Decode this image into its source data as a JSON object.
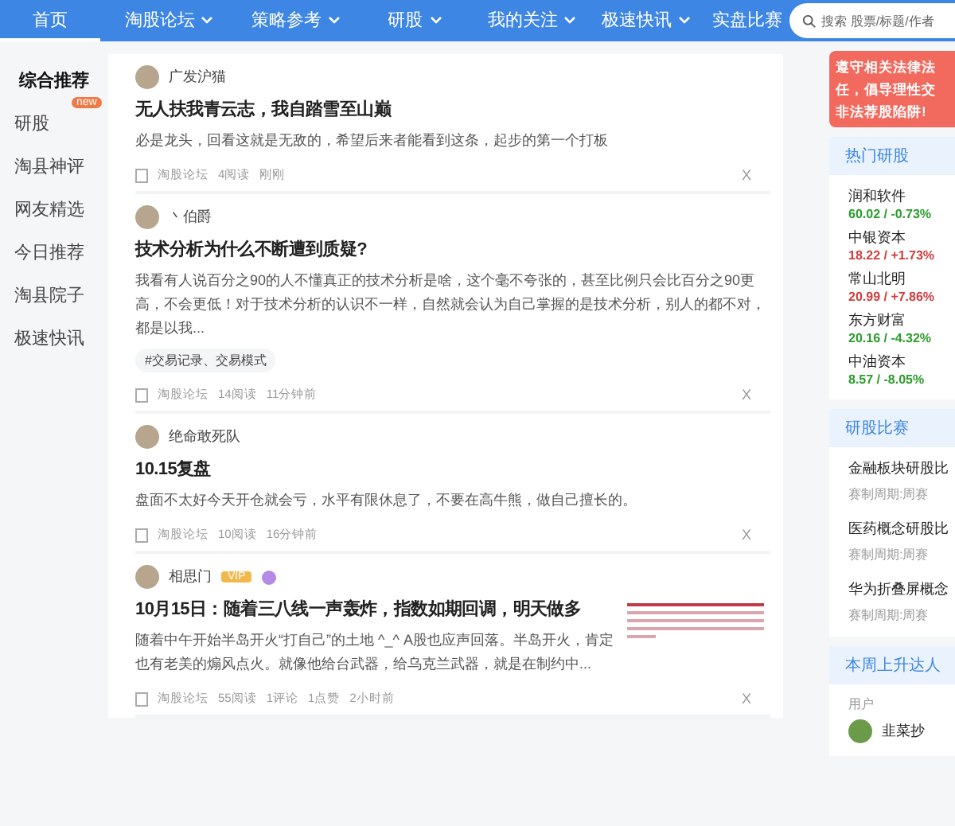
{
  "nav": {
    "items": [
      {
        "label": "首页",
        "selected": true,
        "dropdown": false
      },
      {
        "label": "淘股论坛",
        "selected": false,
        "dropdown": true
      },
      {
        "label": "策略参考",
        "selected": false,
        "dropdown": true
      },
      {
        "label": "研股",
        "selected": false,
        "dropdown": true
      },
      {
        "label": "我的关注",
        "selected": false,
        "dropdown": true
      },
      {
        "label": "极速快讯",
        "selected": false,
        "dropdown": true
      },
      {
        "label": "实盘比赛",
        "selected": false,
        "dropdown": false
      }
    ],
    "search": {
      "placeholder": "搜索 股票/标题/作者"
    }
  },
  "sidebar": {
    "items": [
      {
        "label": "综合推荐",
        "selected": true
      },
      {
        "label": "研股",
        "selected": false,
        "badge": "new"
      },
      {
        "label": "淘县神评",
        "selected": false
      },
      {
        "label": "网友精选",
        "selected": false
      },
      {
        "label": "今日推荐",
        "selected": false
      },
      {
        "label": "淘县院子",
        "selected": false
      },
      {
        "label": "极速快讯",
        "selected": false
      }
    ]
  },
  "feed": [
    {
      "author": "广发沪猫",
      "vip": false,
      "title": "无人扶我青云志，我自踏雪至山巅",
      "summary": "必是龙头，回看这就是无敌的，希望后来者能看到这条，起步的第一个打板",
      "meta": [
        "淘股论坛",
        "4阅读",
        "刚刚"
      ],
      "dismiss": "X",
      "thumbnail": false
    },
    {
      "author": "丶伯爵",
      "vip": false,
      "title": "技术分析为什么不断遭到质疑?",
      "summary": "我看有人说百分之90的人不懂真正的技术分析是啥，这个毫不夸张的，甚至比例只会比百分之90更高，不会更低！对于技术分析的认识不一样，自然就会认为自己掌握的是技术分析，别人的都不对，都是以我...",
      "tags": [
        "#交易记录、交易模式"
      ],
      "meta": [
        "淘股论坛",
        "14阅读",
        "11分钟前"
      ],
      "dismiss": "X",
      "thumbnail": false
    },
    {
      "author": "绝命敢死队",
      "vip": false,
      "title": "10.15复盘",
      "summary": "盘面不太好今天开仓就会亏，水平有限休息了，不要在高牛熊，做自己擅长的。",
      "meta": [
        "淘股论坛",
        "10阅读",
        "16分钟前"
      ],
      "dismiss": "X",
      "thumbnail": false
    },
    {
      "author": "相思门",
      "vip": true,
      "vip_label": "VIP",
      "title": "10月15日：随着三八线一声轰炸，指数如期回调，明天做多",
      "summary": "随着中午开始半岛开火“打自己”的土地 ^_^ A股也应声回落。半岛开火，肯定也有老美的煽风点火。就像他给台武器，给乌克兰武器，就是在制约中...",
      "meta": [
        "淘股论坛",
        "55阅读",
        "1评论",
        "1点赞",
        "2小时前"
      ],
      "dismiss": "X",
      "thumbnail": true
    }
  ],
  "notice": {
    "lines": [
      "遵守相关法律法",
      "任，倡导理性交",
      "非法荐股陷阱!"
    ]
  },
  "hot_stocks": {
    "title": "热门研股",
    "items": [
      {
        "name": "润和软件",
        "quote": "60.02 / -0.73%",
        "color": "#2a9d2a"
      },
      {
        "name": "中银资本",
        "quote": "18.22 / +1.73%",
        "color": "#d23c3c"
      },
      {
        "name": "常山北明",
        "quote": "20.99 / +7.86%",
        "color": "#d23c3c"
      },
      {
        "name": "东方财富",
        "quote": "20.16 / -4.32%",
        "color": "#2a9d2a"
      },
      {
        "name": "中油资本",
        "quote": "8.57 / -8.05%",
        "color": "#2a9d2a"
      }
    ]
  },
  "contests": {
    "title": "研股比赛",
    "items": [
      {
        "name": "金融板块研股比",
        "period": "赛制周期:周赛"
      },
      {
        "name": "医药概念研股比",
        "period": "赛制周期:周赛"
      },
      {
        "name": "华为折叠屏概念",
        "period": "赛制周期:周赛"
      }
    ]
  },
  "risers": {
    "title": "本周上升达人",
    "column": "用户",
    "users": [
      "韭菜抄"
    ]
  }
}
